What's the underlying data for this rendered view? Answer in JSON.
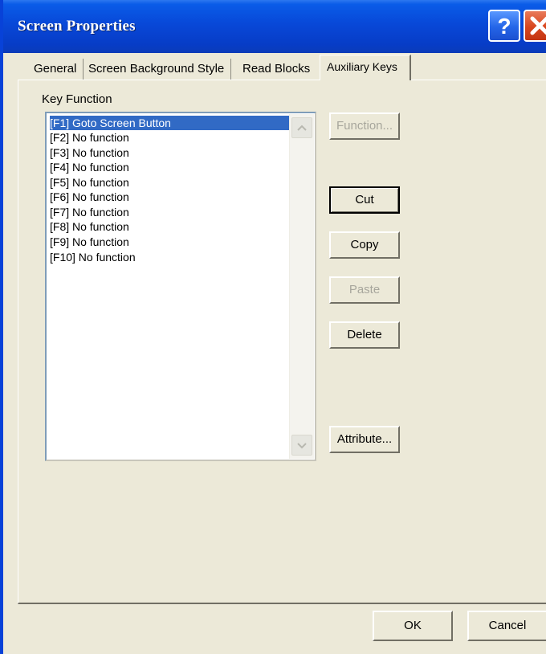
{
  "window": {
    "title": "Screen Properties"
  },
  "tabs": [
    {
      "label": "General",
      "active": false
    },
    {
      "label": "Screen Background Style",
      "active": false
    },
    {
      "label": "Read Blocks",
      "active": false
    },
    {
      "label": "Auxiliary Keys",
      "active": true
    }
  ],
  "key_function": {
    "label": "Key Function",
    "items": [
      "[F1] Goto Screen Button",
      "[F2] No function",
      "[F3] No function",
      "[F4] No function",
      "[F5] No function",
      "[F6] No function",
      "[F7] No function",
      "[F8] No function",
      "[F9] No function",
      "[F10] No function"
    ],
    "selected_index": 0
  },
  "side_buttons": {
    "function": "Function...",
    "cut": "Cut",
    "copy": "Copy",
    "paste": "Paste",
    "delete": "Delete",
    "attribute": "Attribute..."
  },
  "footer": {
    "ok": "OK",
    "cancel": "Cancel"
  }
}
